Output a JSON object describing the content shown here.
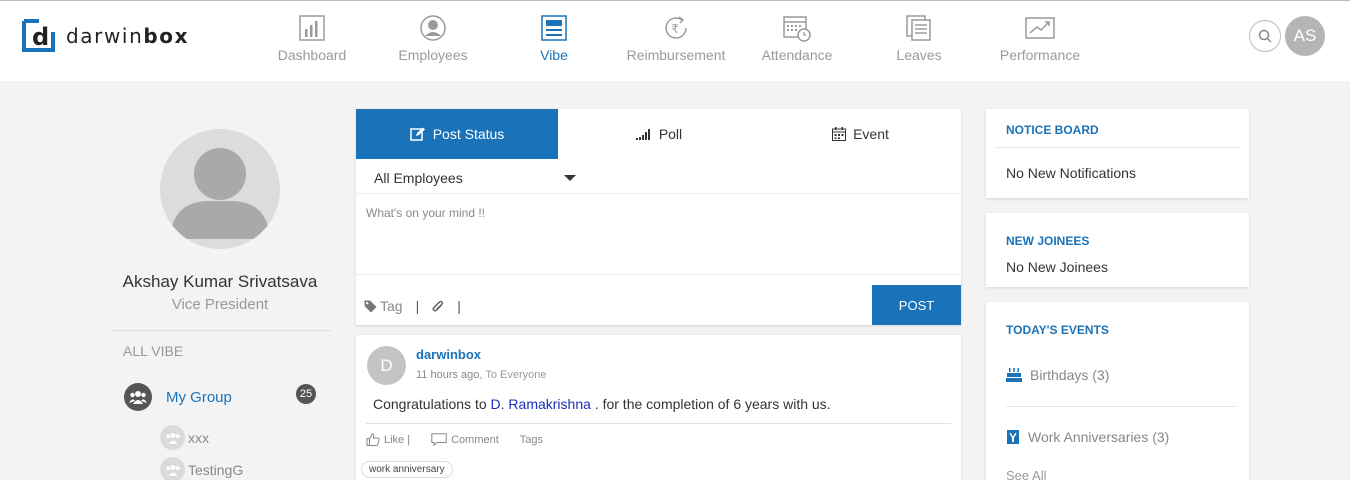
{
  "app": {
    "brand_prefix": "darwin",
    "brand_suffix": "box",
    "user_initials": "AS"
  },
  "nav": [
    {
      "label": "Dashboard",
      "icon": "bar-chart-icon"
    },
    {
      "label": "Employees",
      "icon": "user-circle-icon"
    },
    {
      "label": "Vibe",
      "icon": "newspaper-icon",
      "active": true
    },
    {
      "label": "Reimbursement",
      "icon": "rupee-refresh-icon"
    },
    {
      "label": "Attendance",
      "icon": "calendar-clock-icon"
    },
    {
      "label": "Leaves",
      "icon": "document-stack-icon"
    },
    {
      "label": "Performance",
      "icon": "chart-trend-icon"
    }
  ],
  "profile": {
    "name": "Akshay Kumar Srivatsava",
    "role": "Vice President"
  },
  "sidebar": {
    "section": "ALL VIBE",
    "group_label": "My Group",
    "group_count": "25",
    "sub_groups": [
      "xxx",
      "TestingG"
    ]
  },
  "composer": {
    "tabs": [
      "Post Status",
      "Poll",
      "Event"
    ],
    "audience": "All Employees",
    "placeholder": "What's on your mind !!",
    "tag_label": "Tag",
    "post_label": "POST"
  },
  "feed": {
    "avatar_letter": "D",
    "author": "darwinbox",
    "time": "11 hours ago",
    "audience": ", To Everyone",
    "text_before": "Congratulations to ",
    "mention": "D. Ramakrishna",
    "text_after": " . for the completion of 6 years with us.",
    "like": "Like |",
    "comment": "Comment",
    "tags": "Tags",
    "tag": "work anniversary"
  },
  "notice": {
    "title": "NOTICE BOARD",
    "text": "No New Notifications"
  },
  "joinees": {
    "title": "NEW JOINEES",
    "text": "No New Joinees"
  },
  "events": {
    "title": "TODAY'S EVENTS",
    "birthdays": "Birthdays (3)",
    "anniversaries": "Work Anniversaries  (3)",
    "see_all": "See All"
  },
  "colors": {
    "accent": "#1a73b9",
    "mention": "#1a2fb9",
    "muted": "#9a9a9a"
  }
}
